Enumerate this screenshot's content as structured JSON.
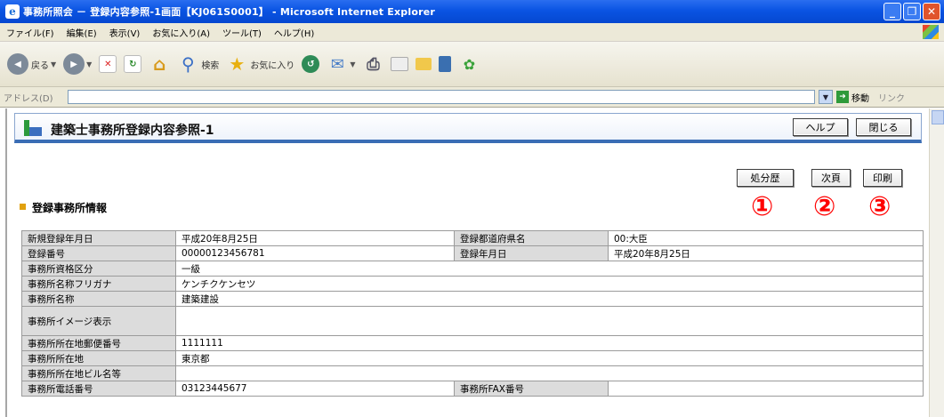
{
  "window": {
    "title": "事務所照会 － 登録内容参照-1画面【KJ061S0001】 - Microsoft Internet Explorer"
  },
  "menu": [
    "ファイル(F)",
    "編集(E)",
    "表示(V)",
    "お気に入り(A)",
    "ツール(T)",
    "ヘルプ(H)"
  ],
  "toolbar": {
    "back_label": "戻る",
    "search_label": "検索",
    "favorites_label": "お気に入り"
  },
  "address": {
    "label": "アドレス(D)",
    "go_label": "移動",
    "links_label": "リンク"
  },
  "page": {
    "title": "建築士事務所登録内容参照-1",
    "help_button": "ヘルプ",
    "close_button": "閉じる",
    "history_button": "処分歴",
    "next_button": "次頁",
    "print_button": "印刷",
    "section_title": "登録事務所情報",
    "markers": [
      "①",
      "②",
      "③"
    ]
  },
  "table": {
    "rows": [
      {
        "l1": "新規登録年月日",
        "v1": "平成20年8月25日",
        "l2": "登録都道府県名",
        "v2": "00:大臣"
      },
      {
        "l1": "登録番号",
        "v1": "00000123456781",
        "l2": "登録年月日",
        "v2": "平成20年8月25日"
      },
      {
        "l1": "事務所資格区分",
        "v1": "一級"
      },
      {
        "l1": "事務所名称フリガナ",
        "v1": "ケンチクケンセツ"
      },
      {
        "l1": "事務所名称",
        "v1": "建築建設"
      },
      {
        "l1": "事務所イメージ表示",
        "v1": ""
      },
      {
        "l1": "事務所所在地郵便番号",
        "v1": "1111111"
      },
      {
        "l1": "事務所所在地",
        "v1": "東京都"
      },
      {
        "l1": "事務所所在地ビル名等",
        "v1": ""
      },
      {
        "l1": "事務所電話番号",
        "v1": "03123445677",
        "l2": "事務所FAX番号",
        "v2": ""
      }
    ]
  }
}
